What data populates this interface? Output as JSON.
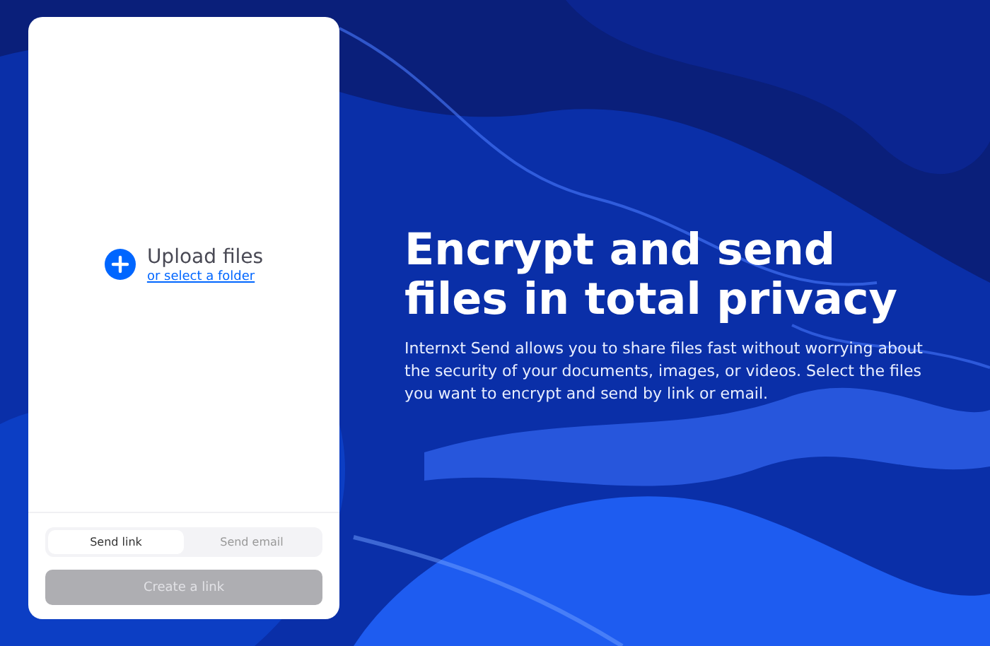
{
  "upload": {
    "title": "Upload files",
    "link": "or select a folder"
  },
  "tabs": [
    {
      "label": "Send link",
      "selected": true
    },
    {
      "label": "Send email",
      "selected": false
    }
  ],
  "action": {
    "label": "Create a link",
    "disabled": true
  },
  "hero": {
    "headline": "Encrypt and send files in total privacy",
    "body": "Internxt Send allows you to share files fast without worrying about the security of your documents, images, or videos. Select the files you want to encrypt and send by link or email."
  }
}
